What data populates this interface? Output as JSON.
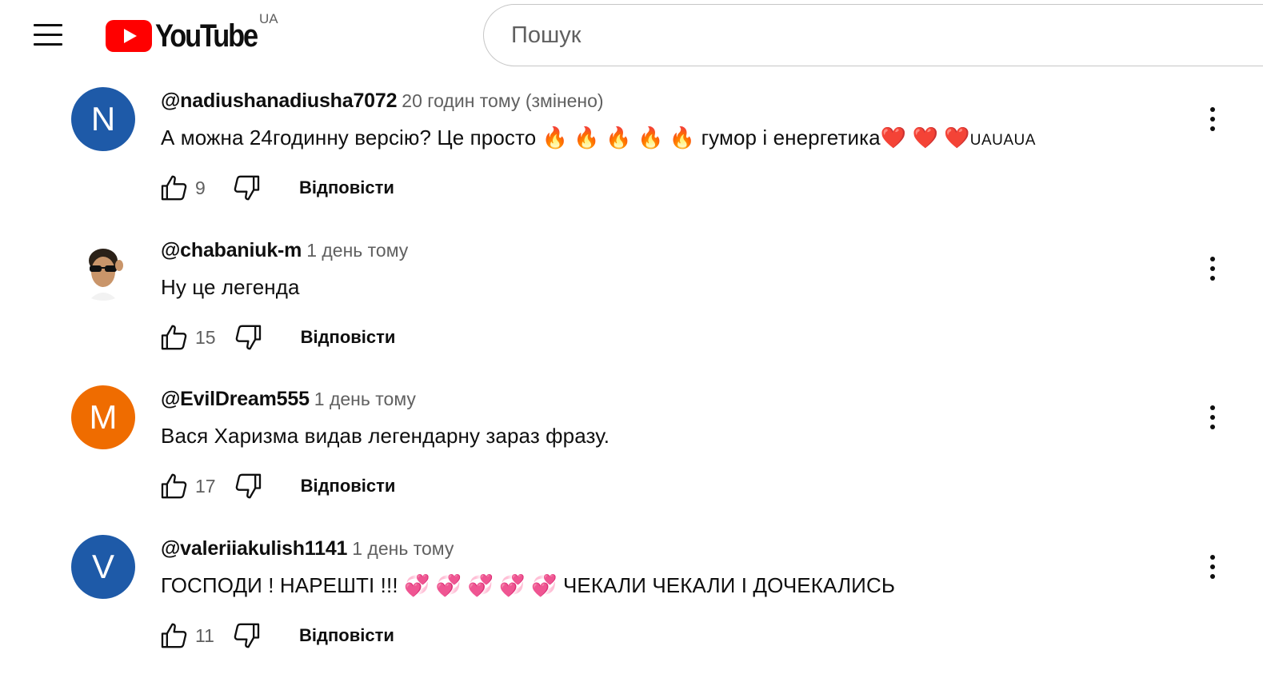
{
  "header": {
    "menu_icon": "hamburger-menu-icon",
    "logo_text": "YouTube",
    "country_code": "UA",
    "brand_color": "#ff0000",
    "search": {
      "placeholder": "Пошук"
    }
  },
  "comments": [
    {
      "avatar_letter": "N",
      "avatar_color": "#1e5aa8",
      "author": "@nadiushanadiusha7072",
      "time": "20 годин тому (змінено)",
      "text": "А можна 24годинну версію? Це просто 🔥 🔥 🔥 🔥 🔥  гумор і енергетика❤️ ❤️ ❤️",
      "text_suffix": "UAUAUA",
      "likes": "9",
      "reply_label": "Відповісти"
    },
    {
      "avatar_letter": "",
      "avatar_color": "#ffffff",
      "author": "@chabaniuk-m",
      "time": "1 день тому",
      "text": "Ну це легенда",
      "text_suffix": "",
      "likes": "15",
      "reply_label": "Відповісти"
    },
    {
      "avatar_letter": "M",
      "avatar_color": "#ef6c00",
      "author": "@EvilDream555",
      "time": "1 день тому",
      "text": "Вася Харизма видав легендарну зараз фразу.",
      "text_suffix": "",
      "likes": "17",
      "reply_label": "Відповісти"
    },
    {
      "avatar_letter": "V",
      "avatar_color": "#1e5aa8",
      "author": "@valeriiakulish1141",
      "time": "1 день тому",
      "text": "ГОСПОДИ ! НАРЕШТІ !!! 💞 💞 💞 💞 💞  ЧЕКАЛИ ЧЕКАЛИ І ДОЧЕКАЛИСЬ",
      "text_suffix": "",
      "likes": "11",
      "reply_label": "Відповісти"
    }
  ]
}
